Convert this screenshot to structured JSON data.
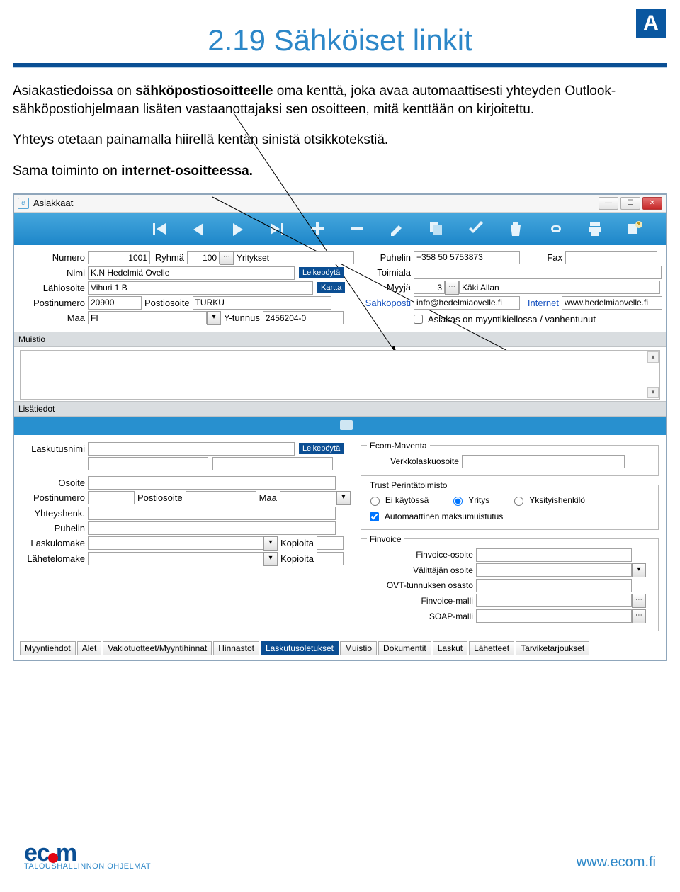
{
  "badge": "A",
  "heading": "2.19 Sähköiset linkit",
  "p1_a": "Asiakastiedoissa on ",
  "p1_link1": "sähköpostiosoitteelle",
  "p1_b": " oma kenttä, joka avaa automaattisesti yhteyden Outlook-sähköpostiohjelmaan lisäten vastaanottajaksi  sen osoitteen, mitä kenttään on kirjoitettu.",
  "p2": "Yhteys otetaan painamalla hiirellä kentän sinistä otsikkotekstiä.",
  "p3_a": "Sama toiminto on ",
  "p3_link": "internet-osoitteessa.",
  "window_title": "Asiakkaat",
  "labels": {
    "numero": "Numero",
    "ryhma": "Ryhmä",
    "nimi": "Nimi",
    "lahiosoite": "Lähiosoite",
    "postinumero": "Postinumero",
    "postiosoite": "Postiosoite",
    "maa": "Maa",
    "ytunnus": "Y-tunnus",
    "puhelin": "Puhelin",
    "fax": "Fax",
    "toimiala": "Toimiala",
    "myyja": "Myyjä",
    "sahkoposti": "Sähköposti",
    "internet": "Internet",
    "asiakas_kielto": "Asiakas on myyntikiellossa / vanhentunut",
    "muistio": "Muistio",
    "lisatiedot": "Lisätiedot",
    "laskutusnimi": "Laskutusnimi",
    "osoite": "Osoite",
    "yhteyshenk": "Yhteyshenk.",
    "laskulomake": "Laskulomake",
    "lahetelomake": "Lähetelomake",
    "kopioita": "Kopioita",
    "ecom_maventa": "Ecom-Maventa",
    "verkkolaskuosoite": "Verkkolaskuosoite",
    "trust": "Trust Perintätoimisto",
    "ei_kaytossa": "Ei käytössä",
    "yritys": "Yritys",
    "yksityis": "Yksityishenkilö",
    "autom": "Automaattinen maksumuistutus",
    "finvoice": "Finvoice",
    "finv_osoite": "Finvoice-osoite",
    "valittajan": "Välittäjän osoite",
    "ovt": "OVT-tunnuksen osasto",
    "finv_malli": "Finvoice-malli",
    "soap_malli": "SOAP-malli",
    "leikepoyta": "Leikepöytä",
    "kartta": "Kartta"
  },
  "values": {
    "numero": "1001",
    "ryhma": "100",
    "ryhma_nimi": "Yritykset",
    "nimi": "K.N Hedelmiä Ovelle",
    "lahiosoite": "Vihuri 1 B",
    "postinumero": "20900",
    "postiosoite": "TURKU",
    "maa": "FI",
    "ytunnus": "2456204-0",
    "puhelin": "+358 50 5753873",
    "fax": "",
    "toimiala": "",
    "myyja_nro": "3",
    "myyja_nimi": "Käki Allan",
    "sahkoposti": "info@hedelmiaovelle.fi",
    "internet": "www.hedelmiaovelle.fi"
  },
  "tabs": [
    "Myyntiehdot",
    "Alet",
    "Vakiotuotteet/Myyntihinnat",
    "Hinnastot",
    "Laskutusoletukset",
    "Muistio",
    "Dokumentit",
    "Laskut",
    "Lähetteet",
    "Tarviketarjoukset"
  ],
  "active_tab": "Laskutusoletukset",
  "footer": {
    "brand": "ecom",
    "tagline": "TALOUSHALLINNON OHJELMAT",
    "url": "www.ecom.fi"
  }
}
